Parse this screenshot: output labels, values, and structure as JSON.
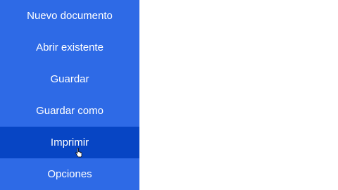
{
  "menu": {
    "items": [
      {
        "label": "Nuevo documento"
      },
      {
        "label": "Abrir existente"
      },
      {
        "label": "Guardar"
      },
      {
        "label": "Guardar como"
      },
      {
        "label": "Imprimir"
      },
      {
        "label": "Opciones"
      }
    ],
    "active_index": 4
  },
  "colors": {
    "menu_background": "#2e6ae6",
    "menu_active": "#0745c4",
    "menu_text": "#ffffff",
    "content_background": "#ffffff"
  },
  "cursor_icon": "hand-pointer-icon"
}
